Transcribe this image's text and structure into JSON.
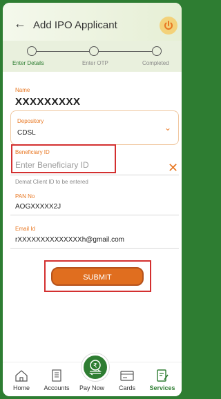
{
  "header": {
    "title": "Add IPO Applicant"
  },
  "steps": [
    "Enter Details",
    "Enter OTP",
    "Completed"
  ],
  "form": {
    "name_label": "Name",
    "name_value": "XXXXXXXXX",
    "depository_label": "Depository",
    "depository_value": "CDSL",
    "beneficiary_label": "Beneficiary ID",
    "beneficiary_placeholder": "Enter Beneficiary ID",
    "beneficiary_hint": "Demat Client ID to be entered",
    "pan_label": "PAN No",
    "pan_value": "AOGXXXXX2J",
    "email_label": "Email Id",
    "email_value": "rXXXXXXXXXXXXXXh@gmail.com"
  },
  "submit_label": "SUBMIT",
  "nav": {
    "home": "Home",
    "accounts": "Accounts",
    "paynow": "Pay Now",
    "cards": "Cards",
    "services": "Services"
  },
  "colors": {
    "brand_green": "#2e7d32",
    "accent_orange": "#e87722",
    "highlight_red": "#d32f2f"
  }
}
